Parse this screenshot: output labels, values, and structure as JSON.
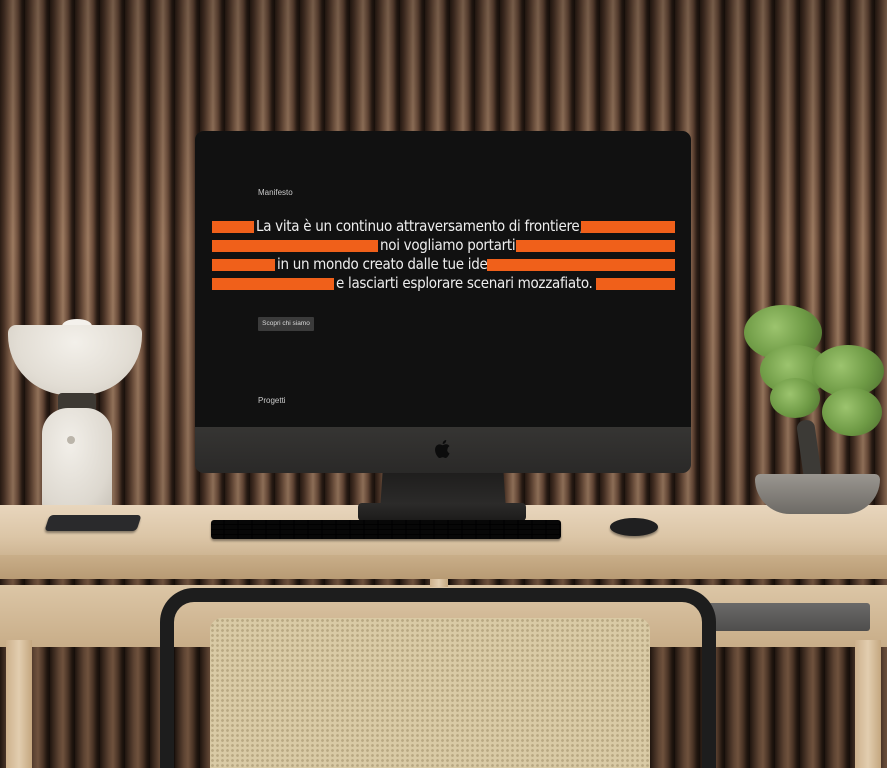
{
  "screen": {
    "nav_top": "Manifesto",
    "manifesto_lines": [
      "La vita è un continuo attraversamento di frontiere,",
      "noi vogliamo portarti",
      "in un mondo creato dalle tue idee",
      "e lasciarti esplorare scenari mozzafiato."
    ],
    "cta_label": "Scopri chi siamo",
    "nav_bottom": "Progetti"
  },
  "colors": {
    "accent": "#f0601a",
    "screen_bg": "#111111"
  },
  "icons": {
    "monitor_logo": "apple-logo-icon"
  }
}
